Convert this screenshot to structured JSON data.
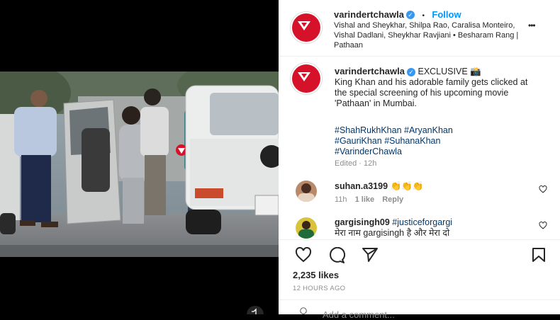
{
  "post": {
    "username": "varindertchawla",
    "follow_label": "Follow",
    "dot": "•",
    "audio": "Vishal and Sheykhar, Shilpa Rao, Caralisa Monteiro, Vishal Dadlani, Sheykhar Ravjiani • Besharam Rang | Pathaan",
    "more": "•••"
  },
  "caption": {
    "username": "varindertchawla",
    "text_first": "EXCLUSIVE 📸",
    "text_body": "King Khan and his adorable family gets clicked at the special screening of his upcoming movie 'Pathaan' in Mumbai.",
    "hashtags": [
      "#ShahRukhKhan",
      "#AryanKhan",
      "#GauriKhan",
      "#SuhanaKhan",
      "#VarinderChawla"
    ],
    "edited": "Edited · 12h"
  },
  "comments": [
    {
      "username": "suhan.a3199",
      "text": "👏👏👏",
      "time": "11h",
      "likes": "1 like",
      "reply": "Reply"
    },
    {
      "username": "gargisingh09",
      "text": "#justiceforgargi",
      "text2": "मेरा नाम gargisingh है और मेरा दो"
    }
  ],
  "stats": {
    "likes": "2,235 likes",
    "time": "12 HOURS AGO"
  },
  "add_comment": "Add a comment..."
}
